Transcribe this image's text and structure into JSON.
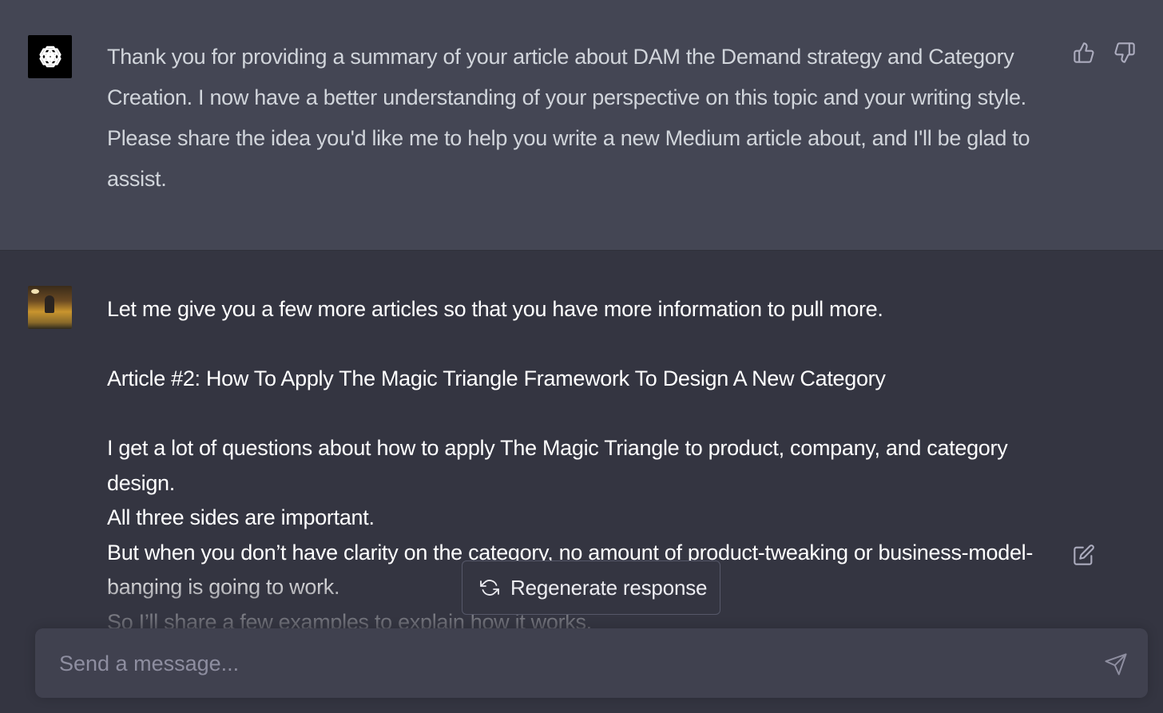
{
  "assistant_message": {
    "text": "Thank you for providing a summary of your article about DAM the Demand strategy and Category Creation. I now have a better understanding of your perspective on this topic and your writing style. Please share the idea you'd like me to help you write a new Medium article about, and I'll be glad to assist."
  },
  "user_message": {
    "lines": [
      "Let me give you a few more articles so that you have more information to pull more.",
      "Article #2: How To Apply The Magic Triangle Framework To Design A New Category",
      "I get a lot of questions about how to apply The Magic Triangle to product, company, and category design.",
      "All three sides are important.",
      "But when you don’t have clarity on the category, no amount of product-tweaking or business-model-banging is going to work.",
      "So I’ll share a few examples to explain how it works."
    ]
  },
  "regenerate": {
    "label": "Regenerate response"
  },
  "composer": {
    "placeholder": "Send a message..."
  },
  "icons": {
    "assistant_avatar": "openai-logo-icon",
    "user_avatar": "user-photo-avatar",
    "thumbs_up": "thumbs-up-icon",
    "thumbs_down": "thumbs-down-icon",
    "edit": "edit-icon",
    "regenerate": "refresh-icon",
    "send": "send-icon"
  },
  "colors": {
    "assistant_bg": "#444654",
    "user_bg": "#343541",
    "input_bg": "#40414f",
    "text_muted": "#d1d5db",
    "placeholder": "#8e8ea0"
  }
}
